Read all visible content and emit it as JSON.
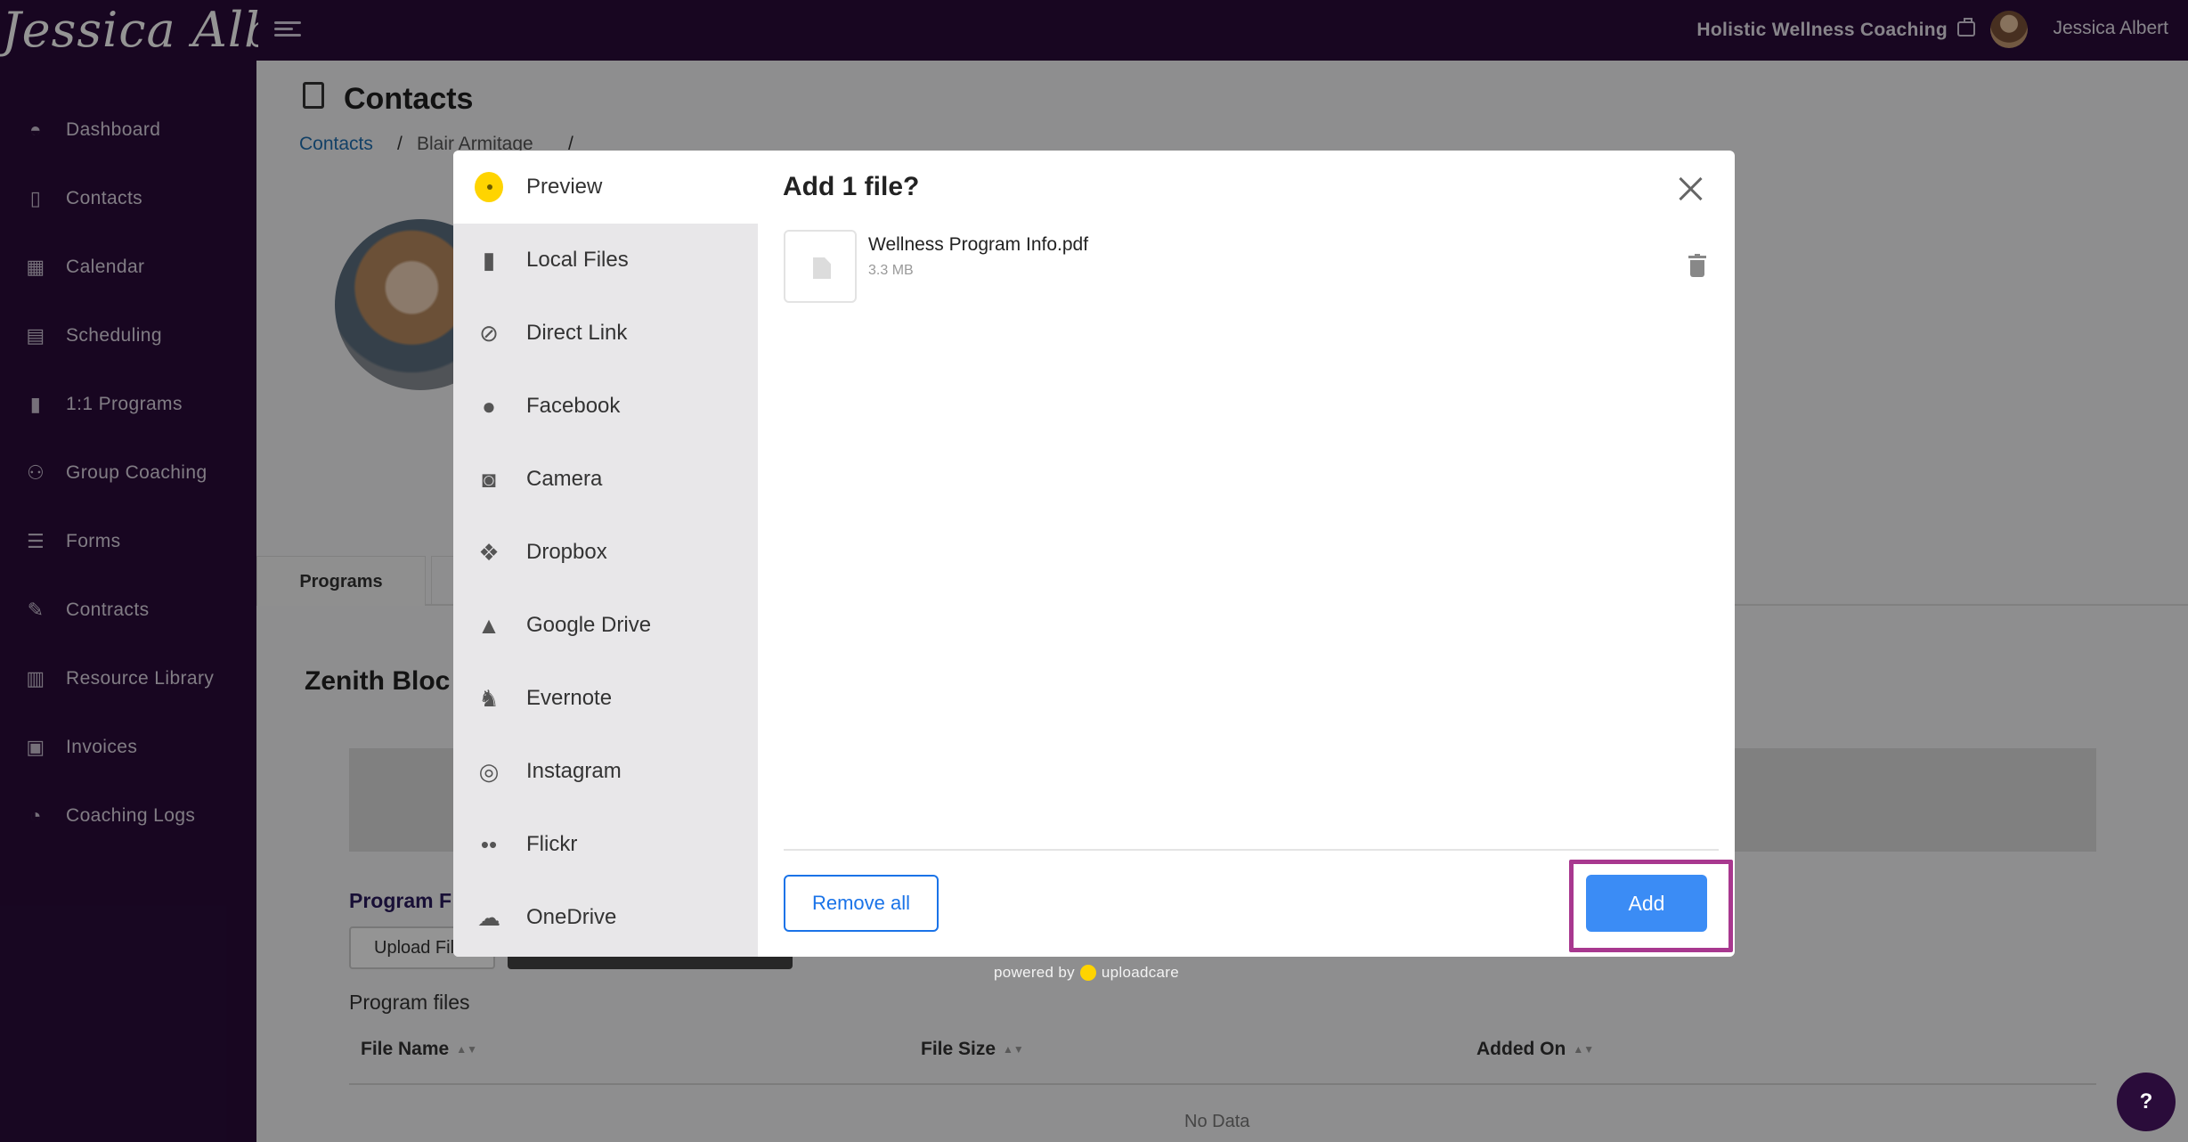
{
  "topbar": {
    "logo_text": "Jessica Albert",
    "business_name": "Holistic Wellness Coaching",
    "user_name": "Jessica Albert"
  },
  "sidebar": {
    "items": [
      {
        "label": "Dashboard",
        "icon": "gauge-icon"
      },
      {
        "label": "Contacts",
        "icon": "contact-book-icon"
      },
      {
        "label": "Calendar",
        "icon": "calendar-icon"
      },
      {
        "label": "Scheduling",
        "icon": "calendar-clock-icon"
      },
      {
        "label": "1:1 Programs",
        "icon": "book-icon"
      },
      {
        "label": "Group Coaching",
        "icon": "users-icon"
      },
      {
        "label": "Forms",
        "icon": "checklist-icon"
      },
      {
        "label": "Contracts",
        "icon": "signature-icon"
      },
      {
        "label": "Resource Library",
        "icon": "library-icon"
      },
      {
        "label": "Invoices",
        "icon": "invoice-icon"
      },
      {
        "label": "Coaching Logs",
        "icon": "clock-icon"
      }
    ]
  },
  "page": {
    "title": "Contacts",
    "breadcrumb": {
      "root": "Contacts",
      "sep": "/",
      "person": "Blair Armitage",
      "sep2": "/"
    },
    "tab_programs": "Programs",
    "section_title": "Zenith Bloc",
    "program_label": "Program F",
    "upload_button": "Upload Fil",
    "program_files_title": "Program files",
    "table_headers": [
      "File Name",
      "File Size",
      "Added On"
    ],
    "no_data": "No Data",
    "help": "?"
  },
  "modal": {
    "sources": [
      {
        "label": "Preview",
        "icon": "preview-dot-icon"
      },
      {
        "label": "Local Files",
        "icon": "file-icon"
      },
      {
        "label": "Direct Link",
        "icon": "link-icon"
      },
      {
        "label": "Facebook",
        "icon": "facebook-icon"
      },
      {
        "label": "Camera",
        "icon": "camera-icon"
      },
      {
        "label": "Dropbox",
        "icon": "dropbox-icon"
      },
      {
        "label": "Google Drive",
        "icon": "google-drive-icon"
      },
      {
        "label": "Evernote",
        "icon": "evernote-icon"
      },
      {
        "label": "Instagram",
        "icon": "instagram-icon"
      },
      {
        "label": "Flickr",
        "icon": "flickr-icon"
      },
      {
        "label": "OneDrive",
        "icon": "onedrive-icon"
      }
    ],
    "title": "Add 1 file?",
    "file": {
      "name": "Wellness Program Info.pdf",
      "size": "3.3 MB"
    },
    "remove_all": "Remove all",
    "add": "Add",
    "powered_by": "powered by",
    "powered_brand": "uploadcare"
  },
  "colors": {
    "sidebar_bg": "#2a0c3a",
    "add_button": "#3b8cf5",
    "highlight": "#a8388f",
    "uploadcare_yellow": "#ffd400"
  }
}
